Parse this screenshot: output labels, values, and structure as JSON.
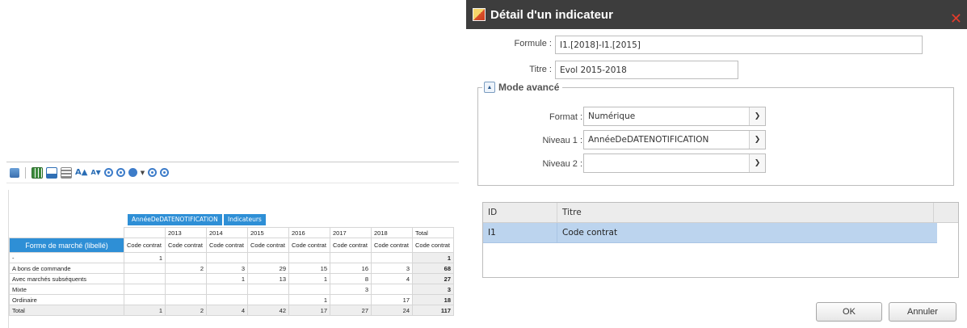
{
  "pivot": {
    "toolbar": {
      "icons": [
        "export-icon",
        "grid-icon",
        "chart-icon",
        "layout-icon",
        "font-increase-icon",
        "font-decrease-icon",
        "expand-all-icon",
        "collapse-all-icon",
        "play-icon",
        "expand-icon",
        "collapse-icon"
      ],
      "font_increase": "A▲",
      "font_decrease": "A▼"
    },
    "column_field": "AnnéeDeDATENOTIFICATION",
    "data_field": "Indicateurs",
    "row_field": "Forme de marché (libellé)",
    "years": [
      "2013",
      "2014",
      "2015",
      "2016",
      "2017",
      "2018",
      "Total"
    ],
    "measure": "Code contrat",
    "rows": [
      {
        "label": "-",
        "values": [
          "1",
          "",
          "",
          "",
          "",
          "",
          "",
          "1"
        ]
      },
      {
        "label": "A bons de commande",
        "values": [
          "",
          "2",
          "3",
          "29",
          "15",
          "16",
          "3",
          "68"
        ]
      },
      {
        "label": "Avec marchés subséquents",
        "values": [
          "",
          "",
          "1",
          "13",
          "1",
          "8",
          "4",
          "27"
        ]
      },
      {
        "label": "Mixte",
        "values": [
          "",
          "",
          "",
          "",
          "",
          "3",
          "",
          "3"
        ]
      },
      {
        "label": "Ordinaire",
        "values": [
          "",
          "",
          "",
          "",
          "1",
          "",
          "17",
          "18"
        ]
      },
      {
        "label": "Total",
        "values": [
          "1",
          "2",
          "4",
          "42",
          "17",
          "27",
          "24",
          "117"
        ]
      }
    ]
  },
  "dialog": {
    "title": "Détail d'un indicateur",
    "formule_label": "Formule :",
    "formule_value": "I1.[2018]-I1.[2015]",
    "titre_label": "Titre :",
    "titre_value": "Evol 2015-2018",
    "advanced_title": "Mode avancé",
    "format_label": "Format :",
    "format_value": "Numérique",
    "niveau1_label": "Niveau 1 :",
    "niveau1_value": "AnnéeDeDATENOTIFICATION",
    "niveau2_label": "Niveau 2 :",
    "niveau2_value": "",
    "grid": {
      "columns": [
        "ID",
        "Titre"
      ],
      "rows": [
        {
          "id": "I1",
          "titre": "Code contrat"
        }
      ]
    },
    "ok_label": "OK",
    "cancel_label": "Annuler",
    "close_glyph": "✕",
    "colors": {
      "titlebar": "#3d3d3d",
      "accent": "#2e8fd6",
      "selected_row": "#bcd4ee",
      "close": "#e43b2b"
    }
  }
}
